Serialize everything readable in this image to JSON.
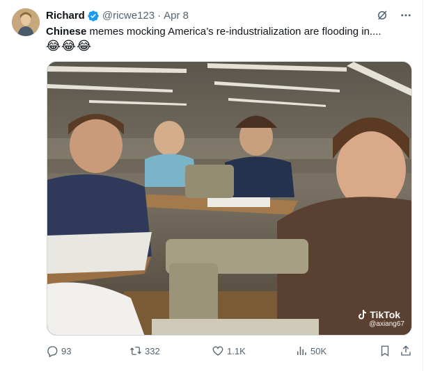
{
  "user": {
    "name": "Richard",
    "handle": "@ricwe123",
    "separator": "·",
    "date": "Apr 8"
  },
  "tweet": {
    "text_bold": "Chinese",
    "text_rest": " memes mocking America’s re-industrialization are flooding in....",
    "emojis": "😂😂😂"
  },
  "media": {
    "watermark_brand": "TikTok",
    "watermark_user": "@axiang67"
  },
  "actions": {
    "replies": "93",
    "reposts": "332",
    "likes": "1.1K",
    "views": "50K"
  },
  "colors": {
    "verified": "#1d9bf0",
    "secondary_text": "#536471",
    "primary_text": "#0f1419"
  },
  "icons": {
    "verified": "verified-badge-icon",
    "grok": "grok-icon",
    "more": "more-icon",
    "reply": "reply-icon",
    "repost": "repost-icon",
    "like": "like-icon",
    "views": "views-icon",
    "bookmark": "bookmark-icon",
    "share": "share-icon"
  }
}
